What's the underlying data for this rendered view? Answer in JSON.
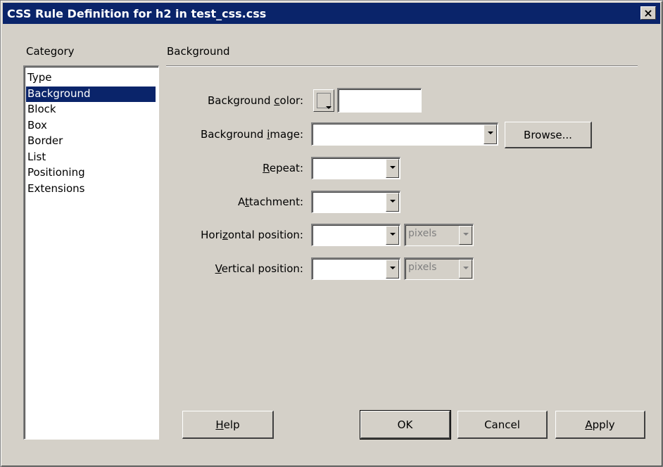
{
  "window": {
    "title": "CSS Rule Definition for h2 in test_css.css",
    "close_glyph": "×"
  },
  "category": {
    "label": "Category",
    "items": [
      "Type",
      "Background",
      "Block",
      "Box",
      "Border",
      "List",
      "Positioning",
      "Extensions"
    ],
    "selected": "Background"
  },
  "section": {
    "title": "Background"
  },
  "fields": {
    "bg_color": {
      "pre": "Background ",
      "u": "c",
      "post": "olor:",
      "value": ""
    },
    "bg_image": {
      "pre": "Background ",
      "u": "i",
      "post": "mage:",
      "value": "",
      "browse": "Browse..."
    },
    "repeat": {
      "pre": "",
      "u": "R",
      "post": "epeat:",
      "value": ""
    },
    "attachment": {
      "pre": "A",
      "u": "t",
      "post": "tachment:",
      "value": ""
    },
    "hpos": {
      "pre": "Hori",
      "u": "z",
      "post": "ontal position:",
      "value": "",
      "unit": "pixels"
    },
    "vpos": {
      "pre": "",
      "u": "V",
      "post": "ertical position:",
      "value": "",
      "unit": "pixels"
    }
  },
  "buttons": {
    "help": {
      "u": "H",
      "post": "elp"
    },
    "ok": "OK",
    "cancel": "Cancel",
    "apply": {
      "u": "A",
      "post": "pply"
    }
  },
  "colors": {
    "title_bg": "#0a246a",
    "face": "#d4d0c8",
    "selection": "#0a246a"
  }
}
